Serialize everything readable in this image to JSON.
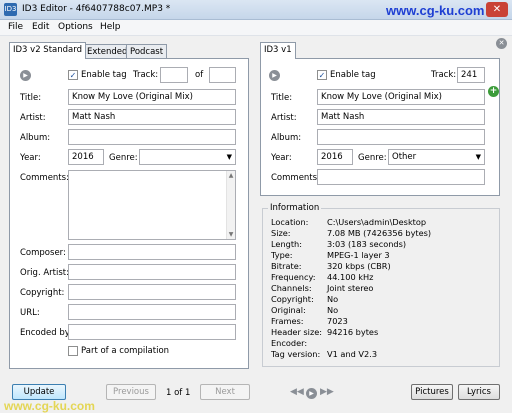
{
  "window": {
    "title": "ID3 Editor - 4f6407788c07.MP3 *",
    "app_icon": "ID3",
    "watermark": "www.cg-ku.com",
    "close_label": "✕"
  },
  "menu": [
    "File",
    "Edit",
    "Options",
    "Help"
  ],
  "v2": {
    "tabs": [
      "ID3 v2 Standard",
      "Extended",
      "Podcast"
    ],
    "enable_tag_label": "Enable tag",
    "enable_tag_checked": true,
    "track_label": "Track:",
    "track_value": "",
    "of_label": "of",
    "of_value": "",
    "title_label": "Title:",
    "title_value": "Know My Love (Original Mix)",
    "artist_label": "Artist:",
    "artist_value": "Matt Nash",
    "album_label": "Album:",
    "album_value": "",
    "year_label": "Year:",
    "year_value": "2016",
    "genre_label": "Genre:",
    "genre_value": "",
    "comments_label": "Comments:",
    "comments_value": "",
    "composer_label": "Composer:",
    "composer_value": "",
    "orig_artist_label": "Orig. Artist:",
    "orig_artist_value": "",
    "copyright_label": "Copyright:",
    "copyright_value": "",
    "url_label": "URL:",
    "url_value": "",
    "encoded_by_label": "Encoded by:",
    "encoded_by_value": "",
    "compilation_label": "Part of a compilation",
    "compilation_checked": false
  },
  "v1": {
    "tab": "ID3 v1",
    "enable_tag_label": "Enable tag",
    "enable_tag_checked": true,
    "track_label": "Track:",
    "track_value": "241",
    "title_label": "Title:",
    "title_value": "Know My Love (Original Mix)",
    "artist_label": "Artist:",
    "artist_value": "Matt Nash",
    "album_label": "Album:",
    "album_value": "",
    "year_label": "Year:",
    "year_value": "2016",
    "genre_label": "Genre:",
    "genre_value": "Other",
    "comments_label": "Comments:",
    "comments_value": ""
  },
  "information": {
    "heading": "Information",
    "rows": [
      {
        "key": "Location:",
        "value": "C:\\Users\\admin\\Desktop"
      },
      {
        "key": "Size:",
        "value": "7.08 MB (7426356 bytes)"
      },
      {
        "key": "Length:",
        "value": "3:03 (183 seconds)"
      },
      {
        "key": "Type:",
        "value": "MPEG-1 layer 3"
      },
      {
        "key": "Bitrate:",
        "value": "320 kbps (CBR)"
      },
      {
        "key": "Frequency:",
        "value": "44.100 kHz"
      },
      {
        "key": "Channels:",
        "value": "Joint stereo"
      },
      {
        "key": "Copyright:",
        "value": "No"
      },
      {
        "key": "Original:",
        "value": "No"
      },
      {
        "key": "Frames:",
        "value": "7023"
      },
      {
        "key": "Header size:",
        "value": "94216 bytes"
      },
      {
        "key": "Encoder:",
        "value": ""
      },
      {
        "key": "Tag version:",
        "value": "V1 and V2.3"
      }
    ]
  },
  "footer": {
    "update": "Update",
    "previous": "Previous",
    "page": "1 of 1",
    "next": "Next",
    "pictures": "Pictures",
    "lyrics": "Lyrics",
    "watermark": "www.cg-ku.com"
  }
}
